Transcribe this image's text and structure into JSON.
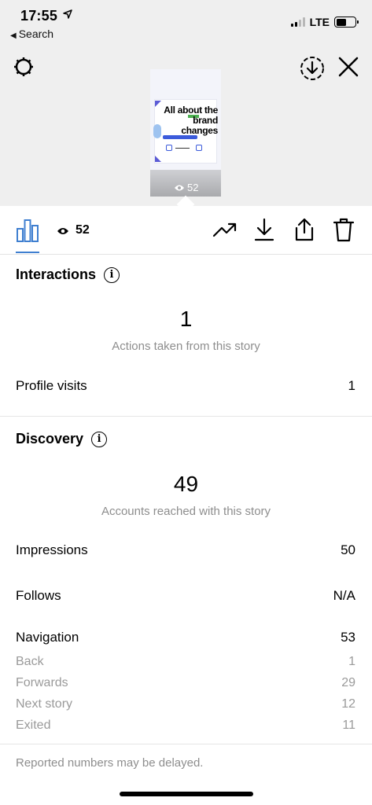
{
  "status": {
    "time": "17:55",
    "back_label": "Search",
    "network": "LTE"
  },
  "thumbnail": {
    "headline": "All about the brand changes",
    "views": "52"
  },
  "toolbar": {
    "view_count": "52"
  },
  "interactions": {
    "title": "Interactions",
    "total": "1",
    "caption": "Actions taken from this story",
    "rows": [
      {
        "label": "Profile visits",
        "value": "1"
      }
    ]
  },
  "discovery": {
    "title": "Discovery",
    "total": "49",
    "caption": "Accounts reached with this story",
    "impressions": {
      "label": "Impressions",
      "value": "50"
    },
    "follows": {
      "label": "Follows",
      "value": "N/A"
    },
    "navigation": {
      "label": "Navigation",
      "value": "53"
    },
    "nav_items": [
      {
        "label": "Back",
        "value": "1"
      },
      {
        "label": "Forwards",
        "value": "29"
      },
      {
        "label": "Next story",
        "value": "12"
      },
      {
        "label": "Exited",
        "value": "11"
      }
    ]
  },
  "footnote": "Reported numbers may be delayed.",
  "colors": {
    "accent": "#3f7fd0",
    "muted": "#8e8e8e"
  }
}
